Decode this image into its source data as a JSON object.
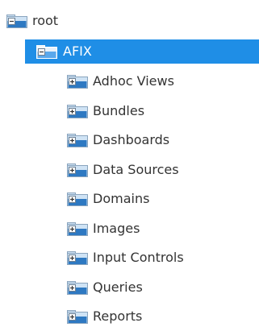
{
  "colors": {
    "selected_bg": "#1f8ee6",
    "folder_blue": "#2e79c2",
    "folder_light": "#cfe3f5",
    "text": "#333333",
    "selected_text": "#ffffff"
  },
  "tree": {
    "root": {
      "label": "root",
      "icon": "folder-collapse-icon",
      "expanded": true
    },
    "selected": {
      "label": "AFIX",
      "icon": "folder-collapse-icon",
      "expanded": true
    },
    "children": [
      {
        "label": "Adhoc Views",
        "icon": "folder-expand-icon"
      },
      {
        "label": "Bundles",
        "icon": "folder-expand-icon"
      },
      {
        "label": "Dashboards",
        "icon": "folder-expand-icon"
      },
      {
        "label": "Data Sources",
        "icon": "folder-expand-icon"
      },
      {
        "label": "Domains",
        "icon": "folder-expand-icon"
      },
      {
        "label": "Images",
        "icon": "folder-expand-icon"
      },
      {
        "label": "Input Controls",
        "icon": "folder-expand-icon"
      },
      {
        "label": "Queries",
        "icon": "folder-expand-icon"
      },
      {
        "label": "Reports",
        "icon": "folder-expand-icon"
      }
    ]
  }
}
